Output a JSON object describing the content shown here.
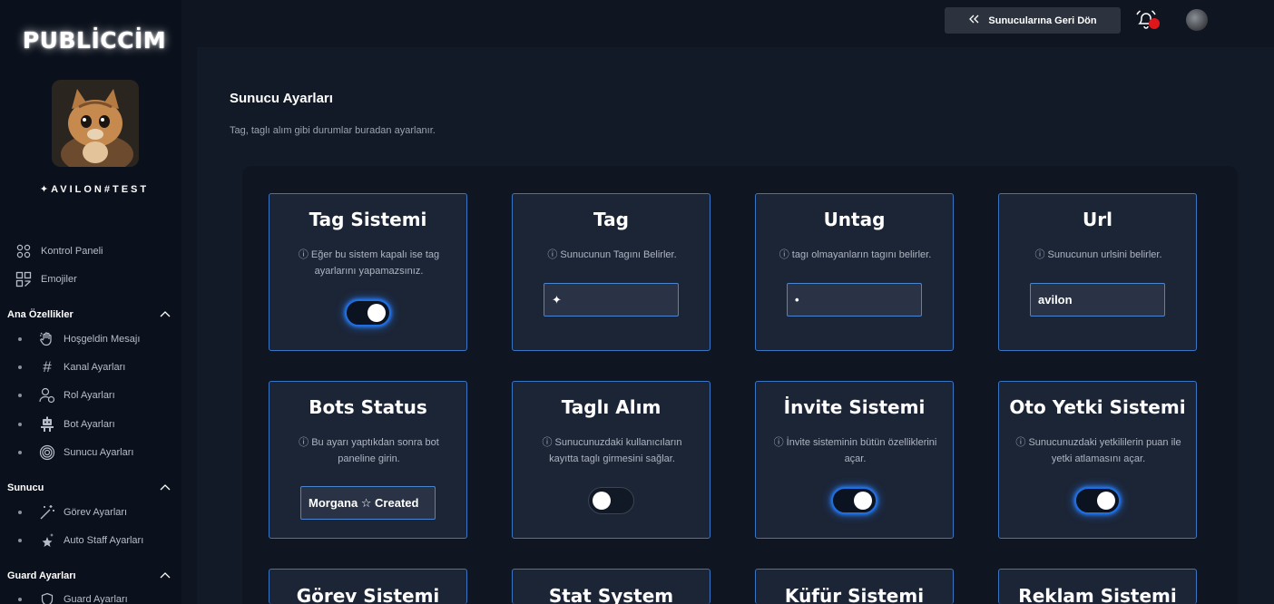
{
  "brand": "PUBLİCCİM",
  "server_name": "✦AVILON#TEST",
  "colors": {
    "accent": "#1f6ee0",
    "card_border": "#3a75c4",
    "card_bg": "#1c2536",
    "notification": "#e0161b"
  },
  "nav": {
    "top_items": [
      {
        "label": "Kontrol Paneli",
        "icon": "grid-icon"
      },
      {
        "label": "Emojiler",
        "icon": "emoji-grid-icon"
      }
    ],
    "sections": [
      {
        "label": "Ana Özellikler",
        "items": [
          {
            "label": "Hoşgeldin Mesajı",
            "icon": "wave-hand-icon"
          },
          {
            "label": "Kanal Ayarları",
            "icon": "hash-icon"
          },
          {
            "label": "Rol Ayarları",
            "icon": "user-role-icon"
          },
          {
            "label": "Bot Ayarları",
            "icon": "robot-icon"
          },
          {
            "label": "Sunucu Ayarları",
            "icon": "fingerprint-icon"
          }
        ]
      },
      {
        "label": "Sunucu",
        "items": [
          {
            "label": "Görev Ayarları",
            "icon": "magic-wand-icon"
          },
          {
            "label": "Auto Staff Ayarları",
            "icon": "stars-icon"
          }
        ]
      },
      {
        "label": "Guard Ayarları",
        "items": [
          {
            "label": "Guard Ayarları",
            "icon": "shield-icon"
          }
        ]
      }
    ]
  },
  "topbar": {
    "back_label": "Sunucularına Geri Dön"
  },
  "page": {
    "title": "Sunucu Ayarları",
    "subtitle": "Tag, taglı alım gibi durumlar buradan ayarlanır."
  },
  "cards": [
    {
      "title": "Tag Sistemi",
      "desc": "ⓘ Eğer bu sistem kapalı ise tag ayarlarını yapamazsınız.",
      "control": "toggle",
      "on": true
    },
    {
      "title": "Tag",
      "desc": "ⓘ Sunucunun Tagını Belirler.",
      "control": "input",
      "value": "✦"
    },
    {
      "title": "Untag",
      "desc": "ⓘ tagı olmayanların tagını belirler.",
      "control": "input",
      "value": "•"
    },
    {
      "title": "Url",
      "desc": "ⓘ Sunucunun urlsini belirler.",
      "control": "input",
      "value": "avilon"
    },
    {
      "title": "Bots Status",
      "desc": "ⓘ Bu ayarı yaptıkdan sonra bot paneline girin.",
      "control": "input",
      "value": "Morgana ☆ Created"
    },
    {
      "title": "Taglı Alım",
      "desc": "ⓘ Sunucunuzdaki kullanıcıların kayıtta taglı girmesini sağlar.",
      "control": "toggle",
      "on": false
    },
    {
      "title": "İnvite Sistemi",
      "desc": "ⓘ İnvite sisteminin bütün özelliklerini açar.",
      "control": "toggle",
      "on": true
    },
    {
      "title": "Oto Yetki Sistemi",
      "desc": "ⓘ Sunucunuzdaki yetkililerin puan ile yetki atlamasını açar.",
      "control": "toggle",
      "on": true
    },
    {
      "title": "Görev Sistemi"
    },
    {
      "title": "Stat System"
    },
    {
      "title": "Küfür Sistemi"
    },
    {
      "title": "Reklam Sistemi"
    }
  ]
}
